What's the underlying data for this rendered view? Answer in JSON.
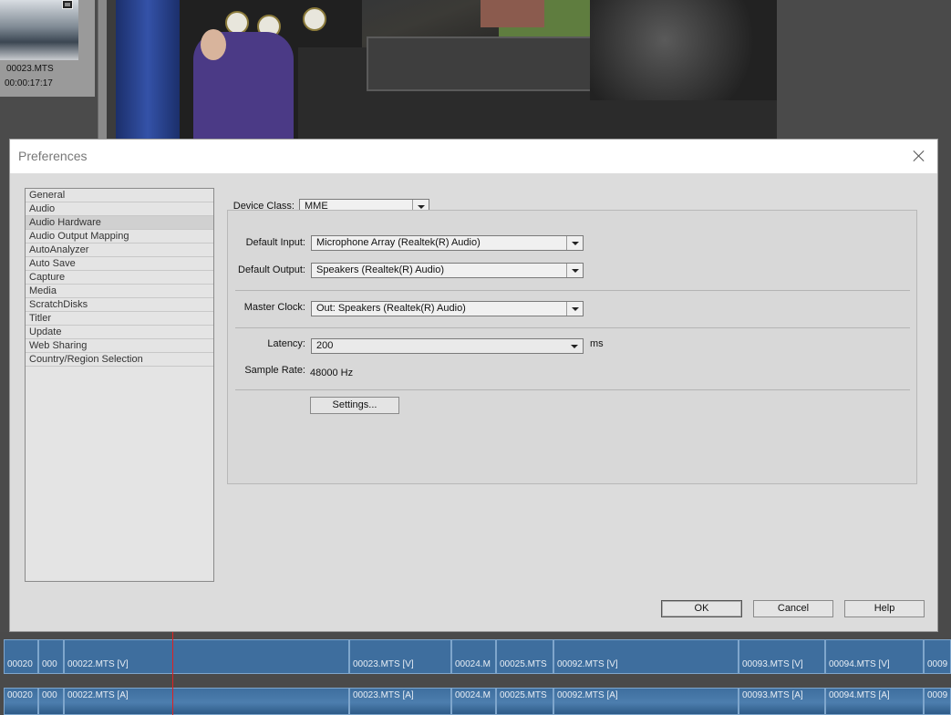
{
  "background": {
    "project_item": {
      "name": "00023.MTS",
      "duration": "00:00:17:17"
    },
    "timeline": {
      "video_clips": [
        {
          "label": "00020"
        },
        {
          "label": "000"
        },
        {
          "label": "00022.MTS [V]"
        },
        {
          "label": "00023.MTS [V]"
        },
        {
          "label": "00024.M"
        },
        {
          "label": "00025.MTS"
        },
        {
          "label": "00092.MTS [V]"
        },
        {
          "label": "00093.MTS [V]"
        },
        {
          "label": "00094.MTS [V]"
        },
        {
          "label": "0009"
        }
      ],
      "audio_clips": [
        {
          "label": "00020"
        },
        {
          "label": "000"
        },
        {
          "label": "00022.MTS [A]"
        },
        {
          "label": "00023.MTS [A]"
        },
        {
          "label": "00024.M"
        },
        {
          "label": "00025.MTS"
        },
        {
          "label": "00092.MTS [A]"
        },
        {
          "label": "00093.MTS [A]"
        },
        {
          "label": "00094.MTS [A]"
        },
        {
          "label": "0009"
        }
      ]
    }
  },
  "dialog": {
    "title": "Preferences",
    "categories": [
      "General",
      "Audio",
      "Audio Hardware",
      "Audio Output Mapping",
      "AutoAnalyzer",
      "Auto Save",
      "Capture",
      "Media",
      "ScratchDisks",
      "Titler",
      "Update",
      "Web Sharing",
      "Country/Region Selection"
    ],
    "selected_category": "Audio Hardware",
    "device_class": {
      "label": "Device Class:",
      "value": "MME"
    },
    "default_input": {
      "label": "Default Input:",
      "value": "Microphone Array (Realtek(R) Audio)"
    },
    "default_output": {
      "label": "Default Output:",
      "value": "Speakers (Realtek(R) Audio)"
    },
    "master_clock": {
      "label": "Master Clock:",
      "value": "Out: Speakers (Realtek(R) Audio)"
    },
    "latency": {
      "label": "Latency:",
      "value": "200",
      "unit": "ms"
    },
    "sample_rate": {
      "label": "Sample Rate:",
      "value": "48000 Hz"
    },
    "settings_button": "Settings...",
    "ok_button": "OK",
    "cancel_button": "Cancel",
    "help_button": "Help"
  }
}
